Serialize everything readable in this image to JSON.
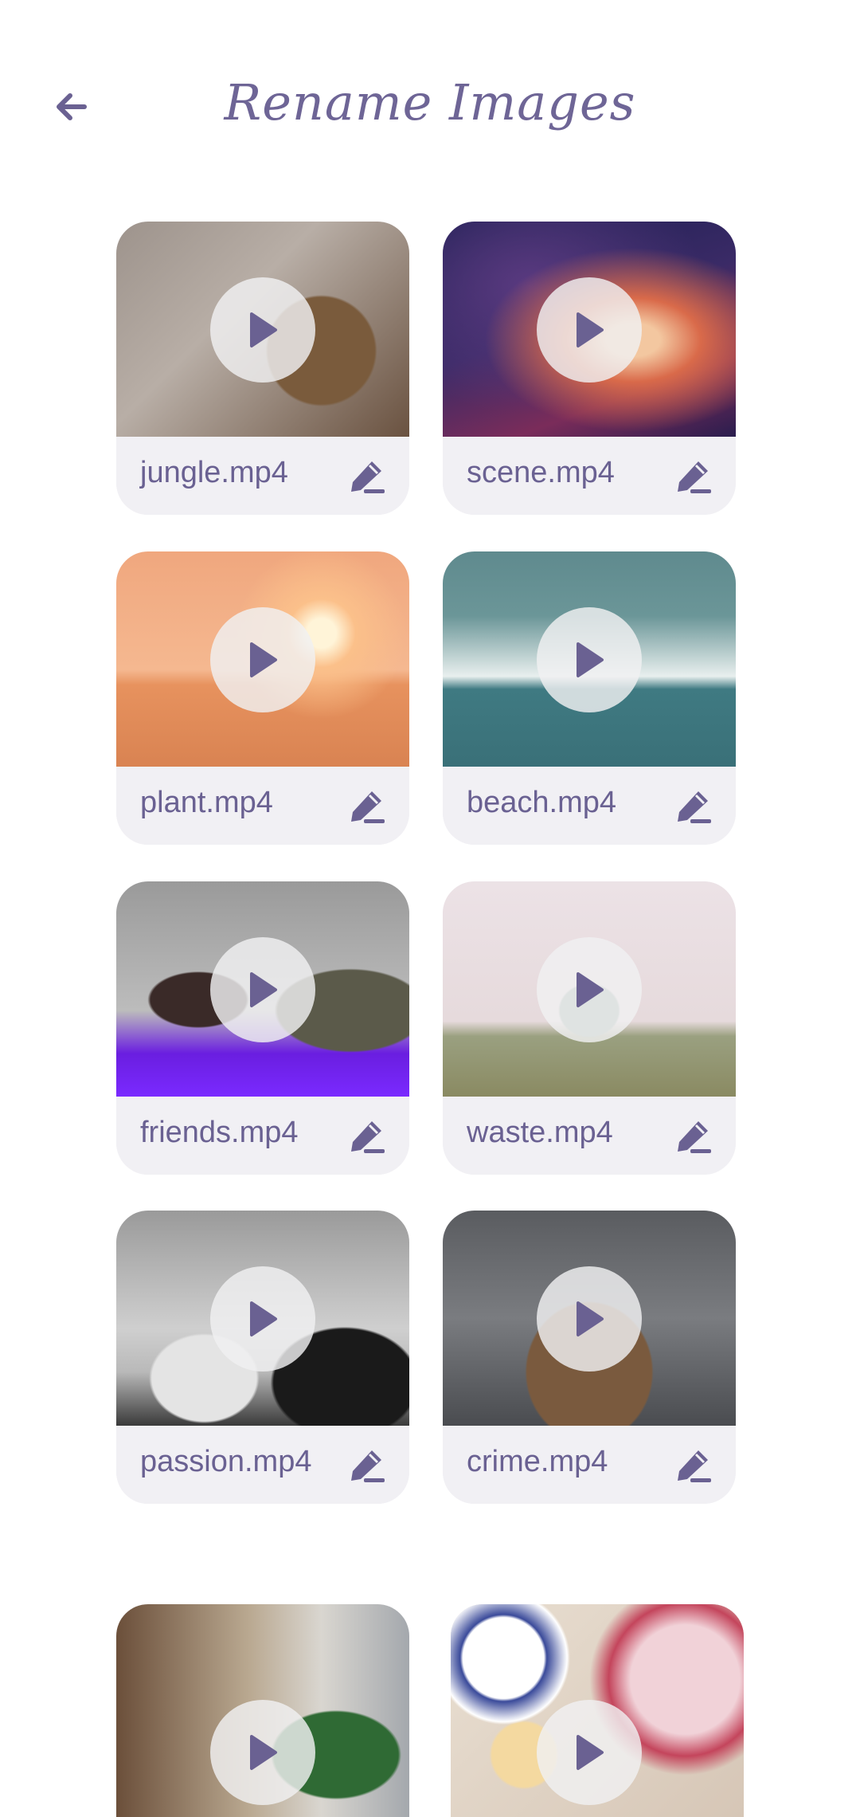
{
  "header": {
    "title": "Rename Images",
    "back_icon": "arrow-left-icon"
  },
  "colors": {
    "accent": "#6a6192",
    "card_bg": "#f1f0f4",
    "background": "#ffffff"
  },
  "videos": [
    {
      "filename": "jungle.mp4"
    },
    {
      "filename": "scene.mp4"
    },
    {
      "filename": "plant.mp4"
    },
    {
      "filename": "beach.mp4"
    },
    {
      "filename": "friends.mp4"
    },
    {
      "filename": "waste.mp4"
    },
    {
      "filename": "passion.mp4"
    },
    {
      "filename": "crime.mp4"
    },
    {
      "filename": ""
    },
    {
      "filename": ""
    }
  ]
}
